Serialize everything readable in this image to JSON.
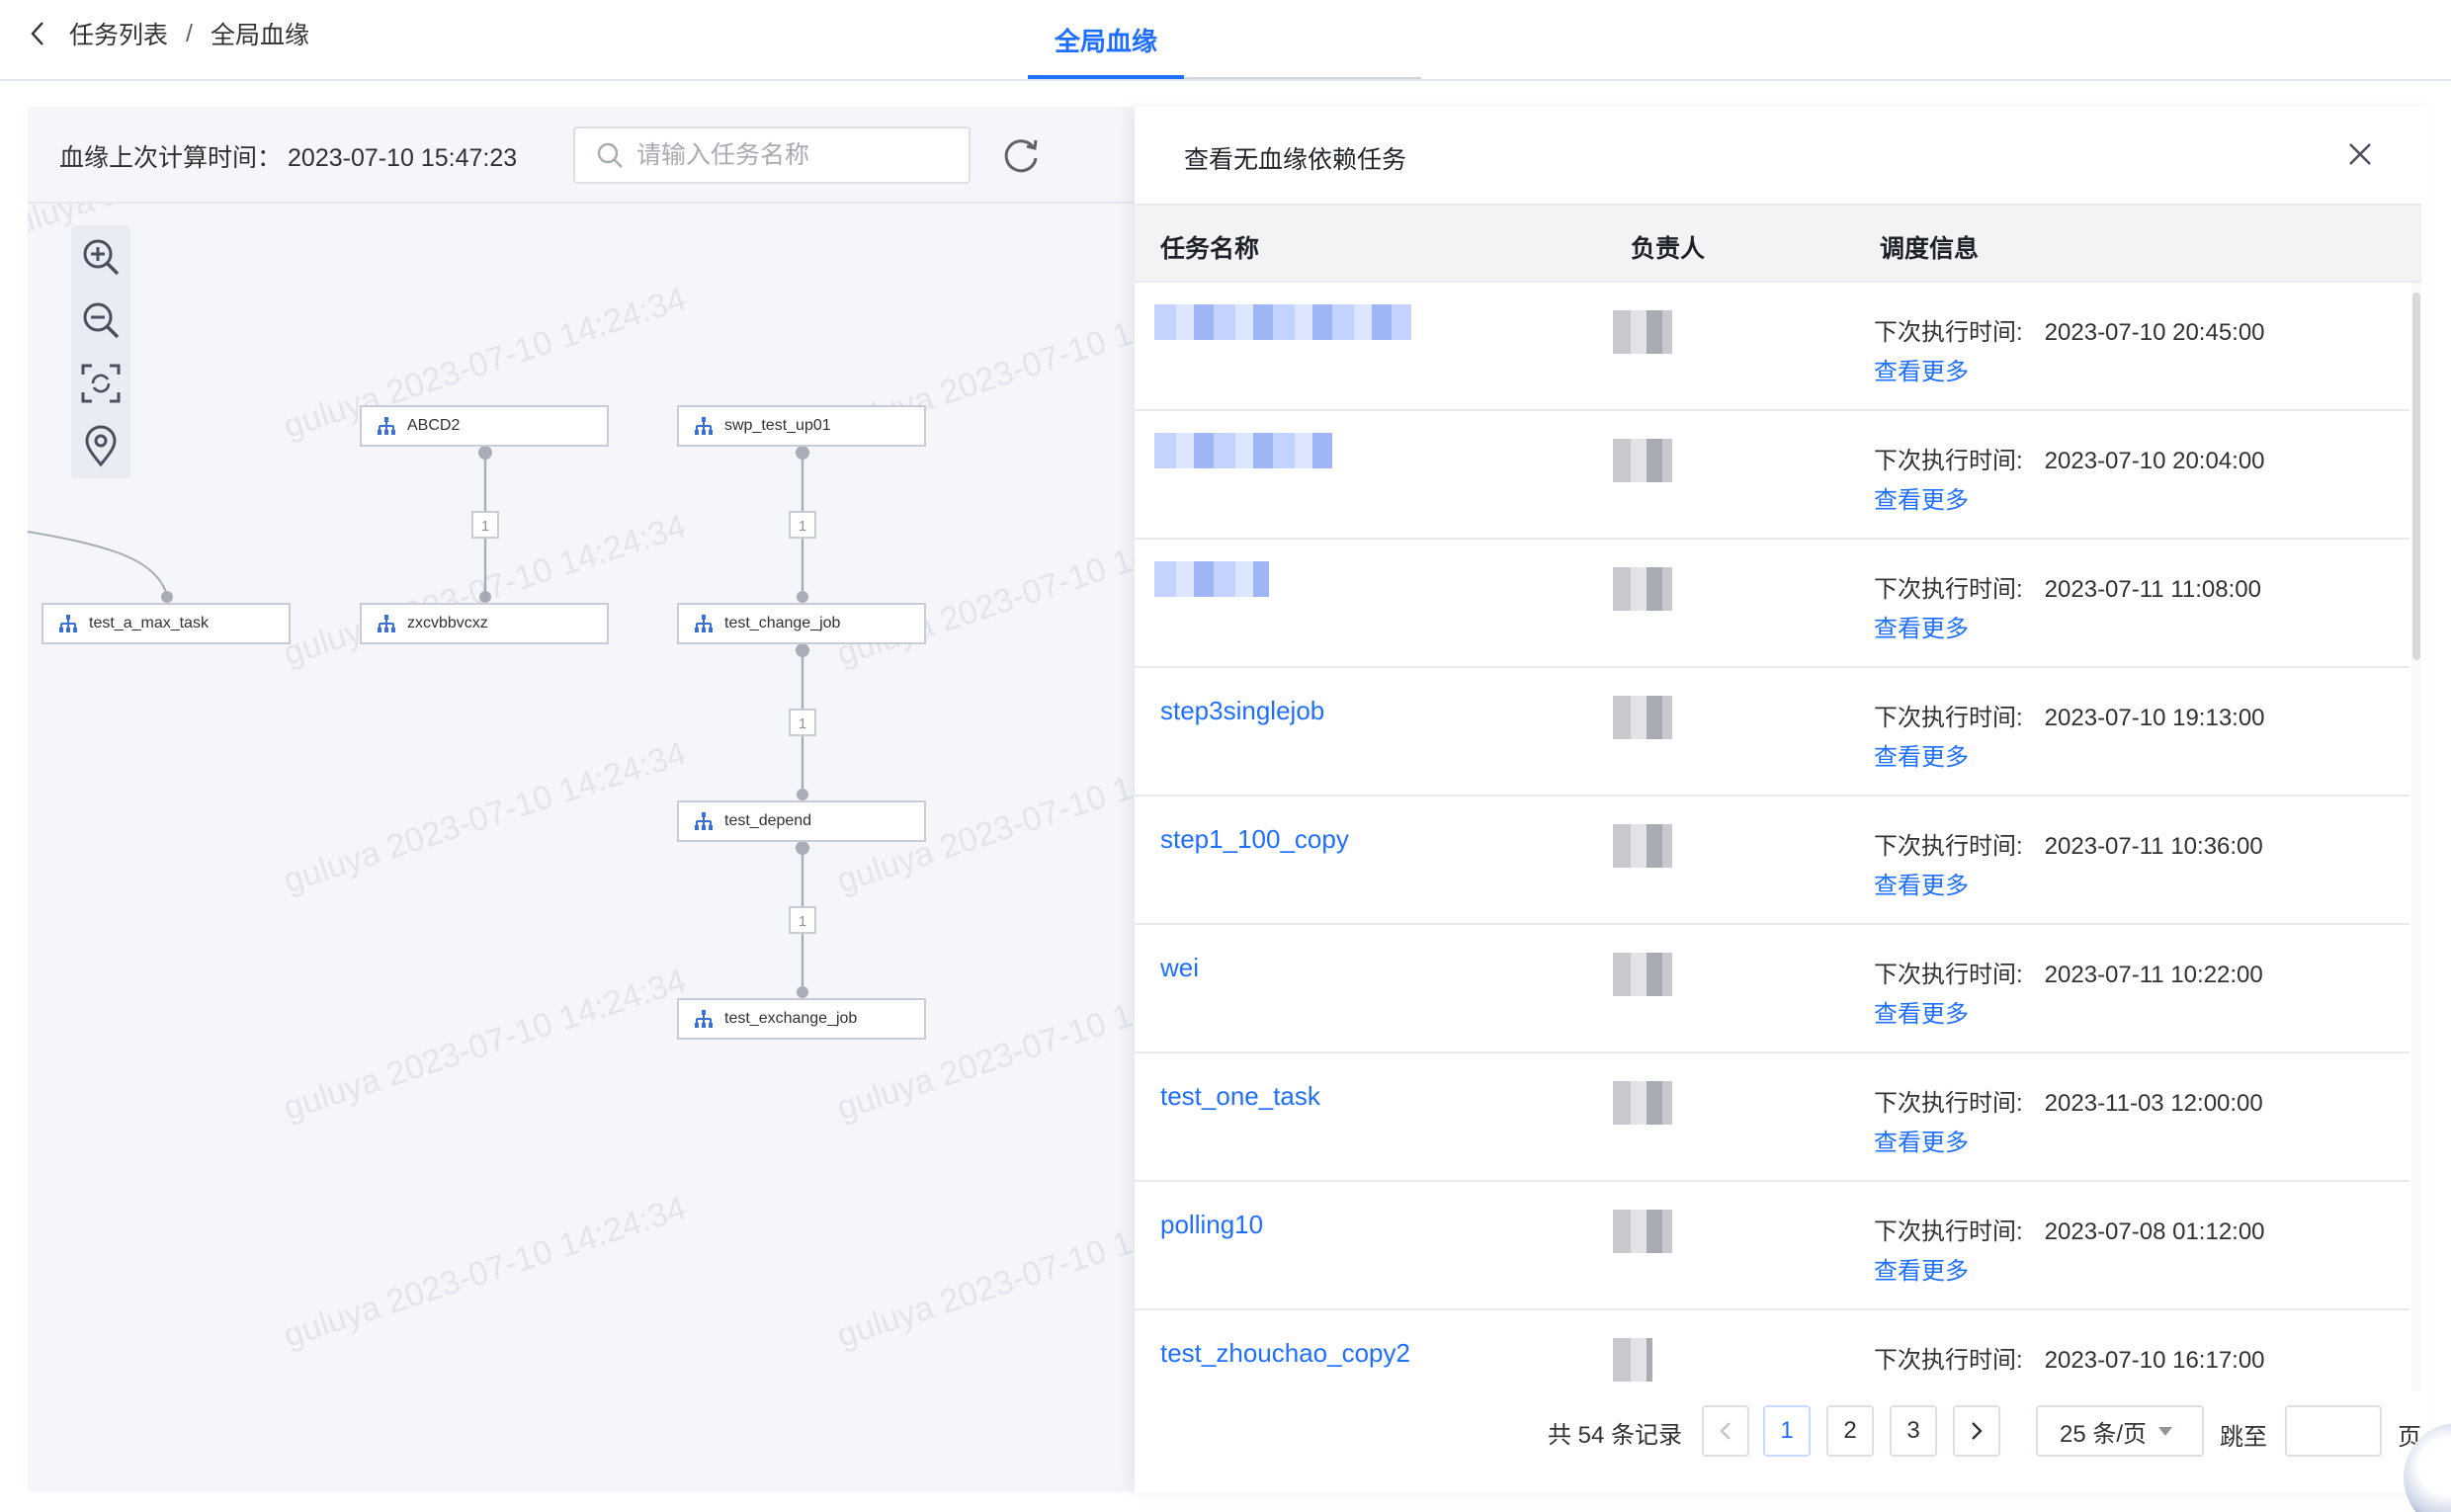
{
  "header": {
    "breadcrumb": [
      "任务列表",
      "全局血缘"
    ],
    "breadcrumb_separator": "/",
    "active_tab": "全局血缘"
  },
  "canvas": {
    "calc_time_label": "血缘上次计算时间：",
    "calc_time_value": "2023-07-10 15:47:23",
    "search_placeholder": "请输入任务名称",
    "watermark_text": "guluya 2023-07-10 14:24:34",
    "nodes": {
      "n1": "test_a_max_task",
      "n2": "ABCD2",
      "n3": "zxcvbbvcxz",
      "n4": "swp_test_up01",
      "n5": "test_change_job",
      "n6": "test_depend",
      "n7": "test_exchange_job"
    },
    "edge_label": "1"
  },
  "panel": {
    "title": "查看无血缘依赖任务",
    "columns": [
      "任务名称",
      "负责人",
      "调度信息"
    ],
    "next_run_label": "下次执行时间:",
    "more_label": "查看更多",
    "rows": [
      {
        "name": "",
        "next_run": "2023-07-10 20:45:00"
      },
      {
        "name": "",
        "next_run": "2023-07-10 20:04:00"
      },
      {
        "name": "",
        "next_run": "2023-07-11 11:08:00"
      },
      {
        "name": "step3singlejob",
        "next_run": "2023-07-10 19:13:00"
      },
      {
        "name": "step1_100_copy",
        "next_run": "2023-07-11 10:36:00"
      },
      {
        "name": "wei",
        "next_run": "2023-07-11 10:22:00"
      },
      {
        "name": "test_one_task",
        "next_run": "2023-11-03 12:00:00"
      },
      {
        "name": "polling10",
        "next_run": "2023-07-08 01:12:00"
      },
      {
        "name": "test_zhouchao_copy2",
        "next_run": "2023-07-10 16:17:00"
      }
    ]
  },
  "pagination": {
    "total_text": "共 54 条记录",
    "pages": [
      "1",
      "2",
      "3"
    ],
    "current_page": "1",
    "page_size": "25 条/页",
    "jump_label": "跳至",
    "page_suffix": "页"
  },
  "colors": {
    "accent": "#1e6fff",
    "canvas_bg": "#f4f6fa",
    "table_head_bg": "#f2f3f5"
  }
}
